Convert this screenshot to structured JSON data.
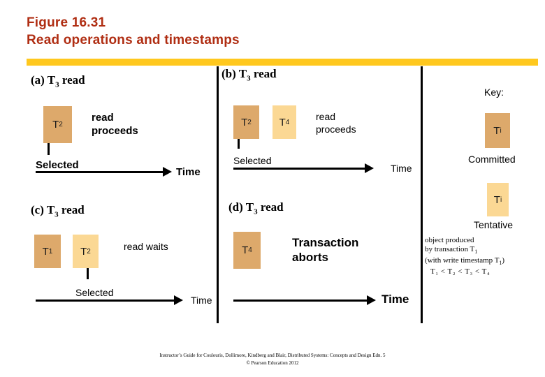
{
  "slide": {
    "title_line1": "Figure 16.31",
    "title_line2": "Read operations and timestamps",
    "title_color": "#B02E13",
    "rule_color": "#FFC81E"
  },
  "colors": {
    "committed": "#DDA96B",
    "tentative": "#FBD894",
    "accent_bar": "#FFC81E",
    "title": "#B02E13"
  },
  "panels": {
    "a": {
      "caption_prefix": "(a)",
      "caption_tx": "T",
      "caption_sub": "3",
      "caption_suffix": "read",
      "boxes": [
        {
          "label": "T",
          "sub": "2",
          "state": "committed"
        }
      ],
      "note": "read\nproceeds",
      "note_line1": "read",
      "note_line2": "proceeds",
      "selected_label": "Selected",
      "axis_label": "Time"
    },
    "b": {
      "caption_prefix": "(b)",
      "caption_tx": "T",
      "caption_sub": "3",
      "caption_suffix": "read",
      "boxes": [
        {
          "label": "T",
          "sub": "2",
          "state": "committed"
        },
        {
          "label": "T",
          "sub": "4",
          "state": "tentative"
        }
      ],
      "note_line1": "read",
      "note_line2": "proceeds",
      "selected_label": "Selected",
      "axis_label": "Time"
    },
    "c": {
      "caption_prefix": "(c)",
      "caption_tx": "T",
      "caption_sub": "3",
      "caption_suffix": "read",
      "boxes": [
        {
          "label": "T",
          "sub": "1",
          "state": "committed"
        },
        {
          "label": "T",
          "sub": "2",
          "state": "tentative"
        }
      ],
      "note_line1": "read waits",
      "selected_label": "Selected",
      "axis_label": "Time"
    },
    "d": {
      "caption_prefix": "(d)",
      "caption_tx": "T",
      "caption_sub": "3",
      "caption_suffix": "read",
      "boxes": [
        {
          "label": "T",
          "sub": "4",
          "state": "committed"
        }
      ],
      "note_line1": "Transaction",
      "note_line2": "aborts",
      "axis_label": "Time"
    }
  },
  "key": {
    "title": "Key:",
    "committed": {
      "box_label": "T",
      "box_sub": "i",
      "caption": "Committed"
    },
    "tentative": {
      "box_label": "T",
      "box_sub": "i",
      "caption": "Tentative"
    },
    "note": {
      "line1": "object produced",
      "line2_a": "by transaction T",
      "line2_sub": "1",
      "line3_a": "(with write timestamp T",
      "line3_sub": "1",
      "line3_b": ")",
      "ordering": "T₁ < T₂ <  T₃ <  T₄"
    }
  },
  "footer": {
    "line1": "Instructor’s Guide for  Coulouris, Dollimore, Kindberg and Blair,  Distributed Systems: Concepts and Design   Edn. 5",
    "line2": "© Pearson Education 2012"
  }
}
